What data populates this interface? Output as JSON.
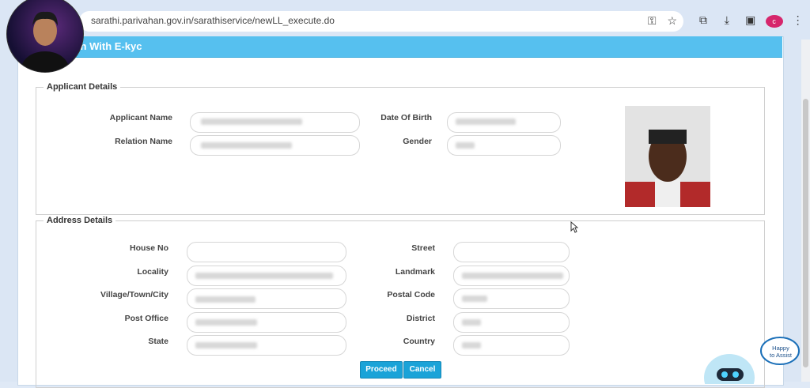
{
  "browser": {
    "url": "sarathi.parivahan.gov.in/sarathiservice/newLL_execute.do",
    "profile_initial": "c"
  },
  "panel": {
    "title": "ion With E-kyc"
  },
  "applicant": {
    "legend": "Applicant Details",
    "labels": {
      "name": "Applicant Name",
      "relation": "Relation Name",
      "dob": "Date Of Birth",
      "gender": "Gender"
    }
  },
  "address": {
    "legend": "Address Details",
    "labels": {
      "house_no": "House No",
      "locality": "Locality",
      "village": "Village/Town/City",
      "post_office": "Post Office",
      "state": "State",
      "street": "Street",
      "landmark": "Landmark",
      "postal_code": "Postal Code",
      "district": "District",
      "country": "Country"
    }
  },
  "buttons": {
    "proceed": "Proceed",
    "cancel": "Cancel"
  },
  "assist": {
    "line1": "Happy",
    "line2": "to Assist"
  },
  "colors": {
    "header": "#56c0ef",
    "button": "#1aa3d8"
  }
}
